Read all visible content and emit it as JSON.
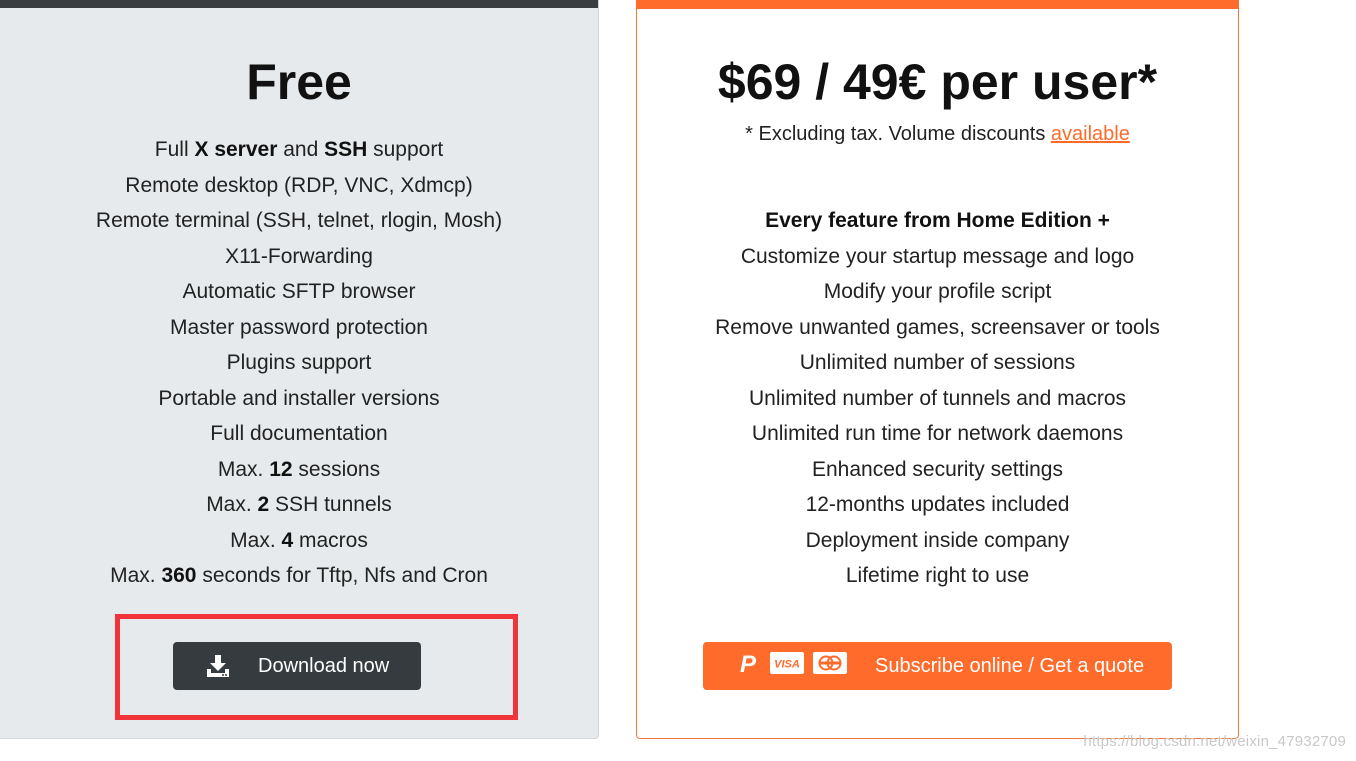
{
  "free": {
    "title": "Free",
    "features": [
      [
        {
          "t": "Full "
        },
        {
          "t": "X server",
          "b": true
        },
        {
          "t": " and "
        },
        {
          "t": "SSH",
          "b": true
        },
        {
          "t": " support"
        }
      ],
      [
        {
          "t": "Remote desktop (RDP, VNC, Xdmcp)"
        }
      ],
      [
        {
          "t": "Remote terminal (SSH, telnet, rlogin, Mosh)"
        }
      ],
      [
        {
          "t": "X11-Forwarding"
        }
      ],
      [
        {
          "t": "Automatic SFTP browser"
        }
      ],
      [
        {
          "t": "Master password protection"
        }
      ],
      [
        {
          "t": "Plugins support"
        }
      ],
      [
        {
          "t": "Portable and installer versions"
        }
      ],
      [
        {
          "t": "Full documentation"
        }
      ],
      [
        {
          "t": "Max. "
        },
        {
          "t": "12",
          "b": true
        },
        {
          "t": " sessions"
        }
      ],
      [
        {
          "t": "Max. "
        },
        {
          "t": "2",
          "b": true
        },
        {
          "t": " SSH tunnels"
        }
      ],
      [
        {
          "t": "Max. "
        },
        {
          "t": "4",
          "b": true
        },
        {
          "t": " macros"
        }
      ],
      [
        {
          "t": "Max. "
        },
        {
          "t": "360",
          "b": true
        },
        {
          "t": " seconds for Tftp, Nfs and Cron"
        }
      ]
    ],
    "button_label": "Download now",
    "button_icon": "download-icon"
  },
  "pro": {
    "title": "$69 / 49€ per user*",
    "note_prefix": "* Excluding tax. Volume discounts ",
    "note_link": "available",
    "features": [
      [
        {
          "t": "Every feature from Home Edition +",
          "b": true
        }
      ],
      [
        {
          "t": "Customize your startup message and logo"
        }
      ],
      [
        {
          "t": "Modify your profile script"
        }
      ],
      [
        {
          "t": "Remove unwanted games, screensaver or tools"
        }
      ],
      [
        {
          "t": "Unlimited number of sessions"
        }
      ],
      [
        {
          "t": "Unlimited number of tunnels and macros"
        }
      ],
      [
        {
          "t": "Unlimited run time for network daemons"
        }
      ],
      [
        {
          "t": "Enhanced security settings"
        }
      ],
      [
        {
          "t": "12-months updates included"
        }
      ],
      [
        {
          "t": "Deployment inside company"
        }
      ],
      [
        {
          "t": "Lifetime right to use"
        }
      ]
    ],
    "button_label": "Subscribe online / Get a quote",
    "payment_icons": [
      "paypal-icon",
      "visa-icon",
      "mastercard-icon"
    ],
    "visa_text": "VISA"
  },
  "colors": {
    "accent": "#ff6b2b",
    "free_bg": "#e6eaec",
    "dark_button": "#363b3f",
    "highlight": "#f0343a"
  },
  "watermark": "https://blog.csdn.net/weixin_47932709"
}
